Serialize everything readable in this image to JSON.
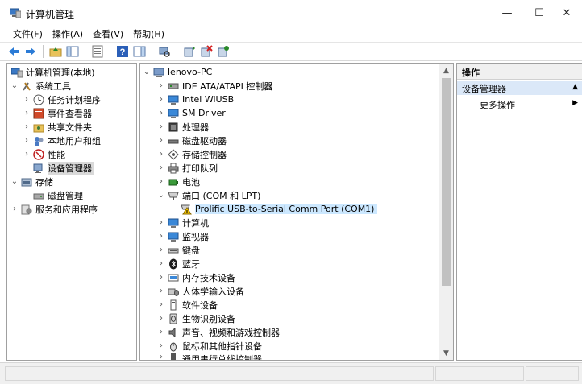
{
  "window": {
    "title": "计算机管理"
  },
  "window_buttons": {
    "minimize": "—",
    "maximize": "☐",
    "close": "✕"
  },
  "menu": [
    {
      "label": "文件(F)"
    },
    {
      "label": "操作(A)"
    },
    {
      "label": "查看(V)"
    },
    {
      "label": "帮助(H)"
    }
  ],
  "left_tree": {
    "root": "计算机管理(本地)",
    "system_tools": "系统工具",
    "items": [
      "任务计划程序",
      "事件查看器",
      "共享文件夹",
      "本地用户和组",
      "性能",
      "设备管理器"
    ],
    "storage": "存储",
    "disk_management": "磁盘管理",
    "services": "服务和应用程序"
  },
  "device_tree": {
    "root": "lenovo-PC",
    "categories": [
      "IDE ATA/ATAPI 控制器",
      "Intel WiUSB",
      "SM Driver",
      "处理器",
      "磁盘驱动器",
      "存储控制器",
      "打印队列",
      "电池",
      "端口 (COM 和 LPT)",
      "Prolific USB-to-Serial Comm Port (COM1)",
      "计算机",
      "监视器",
      "键盘",
      "蓝牙",
      "内存技术设备",
      "人体学输入设备",
      "软件设备",
      "生物识别设备",
      "声音、视频和游戏控制器",
      "鼠标和其他指针设备",
      "通用串行总线控制器"
    ]
  },
  "actions": {
    "header": "操作",
    "section": "设备管理器",
    "more": "更多操作"
  }
}
